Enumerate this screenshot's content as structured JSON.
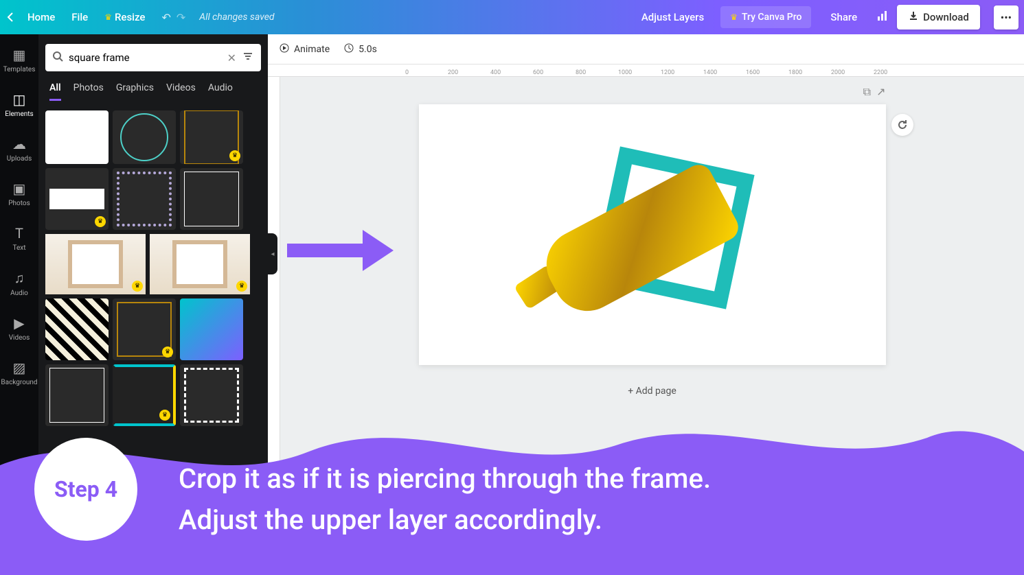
{
  "topbar": {
    "home": "Home",
    "file": "File",
    "resize": "Resize",
    "saved": "All changes saved",
    "adjust_layers": "Adjust Layers",
    "try_pro": "Try Canva Pro",
    "share": "Share",
    "download": "Download"
  },
  "rail": {
    "templates": "Templates",
    "elements": "Elements",
    "uploads": "Uploads",
    "photos": "Photos",
    "text": "Text",
    "audio": "Audio",
    "videos": "Videos",
    "background": "Background"
  },
  "search": {
    "value": "square frame"
  },
  "tabs": {
    "all": "All",
    "photos": "Photos",
    "graphics": "Graphics",
    "videos": "Videos",
    "audio": "Audio"
  },
  "context": {
    "animate": "Animate",
    "duration": "5.0s"
  },
  "ruler": {
    "ticks": [
      "0",
      "200",
      "400",
      "600",
      "800",
      "1000",
      "1200",
      "1400",
      "1600",
      "1800",
      "2000",
      "2200"
    ]
  },
  "canvas": {
    "add_page": "+ Add page"
  },
  "tutorial": {
    "step": "Step 4",
    "line1": "Crop it as if it is piercing through the frame.",
    "line2": "Adjust the upper layer accordingly."
  },
  "colors": {
    "accent": "#8b5cf6",
    "teal": "#1fbdb8"
  }
}
